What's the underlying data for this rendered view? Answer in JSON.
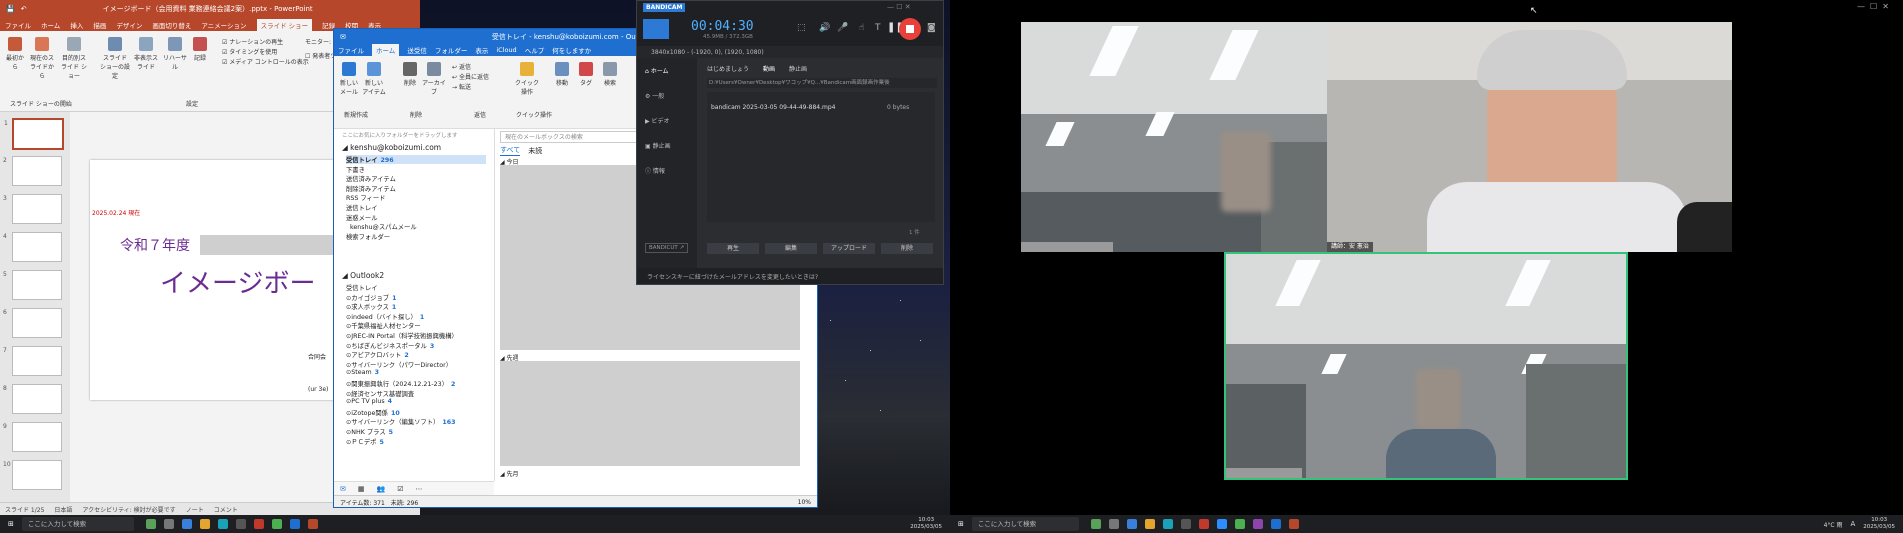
{
  "powerpoint": {
    "title": "イメージボード（会用資料 業務連絡会議2案）.pptx - PowerPoint",
    "tabs": [
      "ファイル",
      "ホーム",
      "挿入",
      "描画",
      "デザイン",
      "画面切り替え",
      "アニメーション",
      "スライド ショー",
      "記録",
      "校閲",
      "表示",
      "ヘルプ"
    ],
    "active_tab": "スライド ショー",
    "ribbon": {
      "btn1": "最初から",
      "btn2": "現在のスライドから",
      "btn3": "目的別スライド ショー",
      "btn4": "スライド ショーの設定",
      "btn5": "非表示スライド",
      "btn6": "リハーサル",
      "btn7": "記録",
      "chk1": "ナレーションの再生",
      "chk2": "タイミングを使用",
      "chk3": "メディア コントロールの表示",
      "monitor": "モニター:",
      "presenter": "発表者ツール",
      "group1": "スライド ショーの開始",
      "group2": "設定"
    },
    "slide_date": "2025.02.24 現在",
    "slide_heading": "令和７年度",
    "slide_big": "イメージボー",
    "slide_sub1": "合同会",
    "slide_sub2": "(ur 3e)",
    "slide_count": "スライド 1/25",
    "status_lang": "日本語",
    "status_access": "アクセシビリティ: 検討が必要です",
    "status_notes": "ノート",
    "status_comments": "コメント"
  },
  "outlook": {
    "title": "受信トレイ - kenshu@koboizumi.com - Outlook",
    "tabs": [
      "ファイル",
      "ホーム",
      "送受信",
      "フォルダー",
      "表示",
      "iCloud",
      "ヘルプ",
      "何をしますか"
    ],
    "active_tab": "ホーム",
    "search_placeholder": "現在のメールボックスの検索",
    "ribbon_new_mail": "新しいメール",
    "ribbon_new_items": "新しいアイテム",
    "ribbon_delete": "削除",
    "ribbon_archive": "アーカイブ",
    "ribbon_reply": "返信",
    "ribbon_replyall": "全員に返信",
    "ribbon_forward": "転送",
    "ribbon_quick": "クイック操作",
    "ribbon_move": "移動",
    "ribbon_tags": "タグ",
    "ribbon_find": "検索",
    "ribbon_group_new": "新規作成",
    "ribbon_group_delete": "削除",
    "ribbon_group_respond": "返信",
    "ribbon_group_quick": "クイック操作",
    "folder_hint": "ここにお気に入りフォルダーをドラッグします",
    "account1": "kenshu@koboizumi.com",
    "folders1": [
      {
        "name": "受信トレイ",
        "count": "296"
      },
      {
        "name": "下書き",
        "count": ""
      },
      {
        "name": "送信済みアイテム",
        "count": ""
      },
      {
        "name": "削除済みアイテム",
        "count": ""
      },
      {
        "name": "RSS フィード",
        "count": ""
      },
      {
        "name": "送信トレイ",
        "count": ""
      },
      {
        "name": "迷惑メール",
        "count": ""
      },
      {
        "name": "kenshu@スパムメール",
        "count": ""
      },
      {
        "name": "検索フォルダー",
        "count": ""
      }
    ],
    "account2": "Outlook2",
    "folders2": [
      {
        "name": "受信トレイ",
        "count": ""
      },
      {
        "name": "⊙カイゴジョブ",
        "count": "1"
      },
      {
        "name": "⊙求人ボックス",
        "count": "1"
      },
      {
        "name": "⊙indeed（バイト探し）",
        "count": "1"
      },
      {
        "name": "⊙千葉県福祉人材センター",
        "count": ""
      },
      {
        "name": "⊙JREC-IN Portal（科学技術振興機構）",
        "count": ""
      },
      {
        "name": "⊙ちばぎんビジネスポータル",
        "count": "3"
      },
      {
        "name": "⊙アビアクロバット",
        "count": "2"
      },
      {
        "name": "⊙サイバーリンク（パワーDirector）",
        "count": ""
      },
      {
        "name": "⊙Steam",
        "count": "3"
      },
      {
        "name": "⊙関東振興執行（2024.12.21-23）",
        "count": "2"
      },
      {
        "name": "⊙経済センサス基礎調査",
        "count": ""
      },
      {
        "name": "⊙PC TV plus",
        "count": "4"
      },
      {
        "name": "⊙iZotope関係",
        "count": "10"
      },
      {
        "name": "⊙サイバーリンク（編集ソフト）",
        "count": "163"
      },
      {
        "name": "⊙NHK プラス",
        "count": "5"
      },
      {
        "name": "⊙ＰＣデポ",
        "count": "5"
      }
    ],
    "list_tab_all": "すべて",
    "list_tab_unread": "未読",
    "group_today": "今日",
    "group_earlier": "先週",
    "group_older": "先月",
    "status_items": "アイテム数: 371",
    "status_unread": "未読: 296",
    "zoom": "10%"
  },
  "bandicam": {
    "logo": "BANDICAM",
    "time": "00:04:30",
    "size": "45.9MB / 372.3GB",
    "resolution_line": "3840x1080 - (-1920, 0), (1920, 1080)",
    "nav": [
      "ホーム",
      "一般",
      "ビデオ",
      "静止画",
      "情報"
    ],
    "tab_start": "はじめましょう",
    "tab_video": "動画",
    "tab_image": "静止画",
    "path": "D:¥Users¥Owner¥Desktop¥ワコップ¥Q...¥Bandicam画面録画作業後",
    "file_name": "bandicam 2025-03-05 09-44-49-884.mp4",
    "file_size": "0 bytes",
    "count_label": "1 件",
    "btn_play": "再生",
    "btn_edit": "編集",
    "btn_upload": "アップロード",
    "btn_delete": "削除",
    "bandicut": "BANDICUT ↗",
    "footer_msg": "ライセンスキーに紐づけたメールアドレスを変更したいときは?"
  },
  "taskbar1": {
    "search_placeholder": "ここに入力して検索",
    "time": "10:03",
    "date": "2025/03/05"
  },
  "taskbar2": {
    "search_placeholder": "ここに入力して検索",
    "weather": "4°C 雨",
    "lang": "A",
    "time": "10:03",
    "date": "2025/03/05"
  },
  "video_call": {
    "tile2_label": "講師：安 憲治",
    "tile1_label": "",
    "tile3_label": ""
  },
  "colors": {
    "ppt": "#b7472a",
    "outlook": "#1e6fd0",
    "bandicam_rec": "#e8413a",
    "active_speaker": "#35c27a"
  }
}
